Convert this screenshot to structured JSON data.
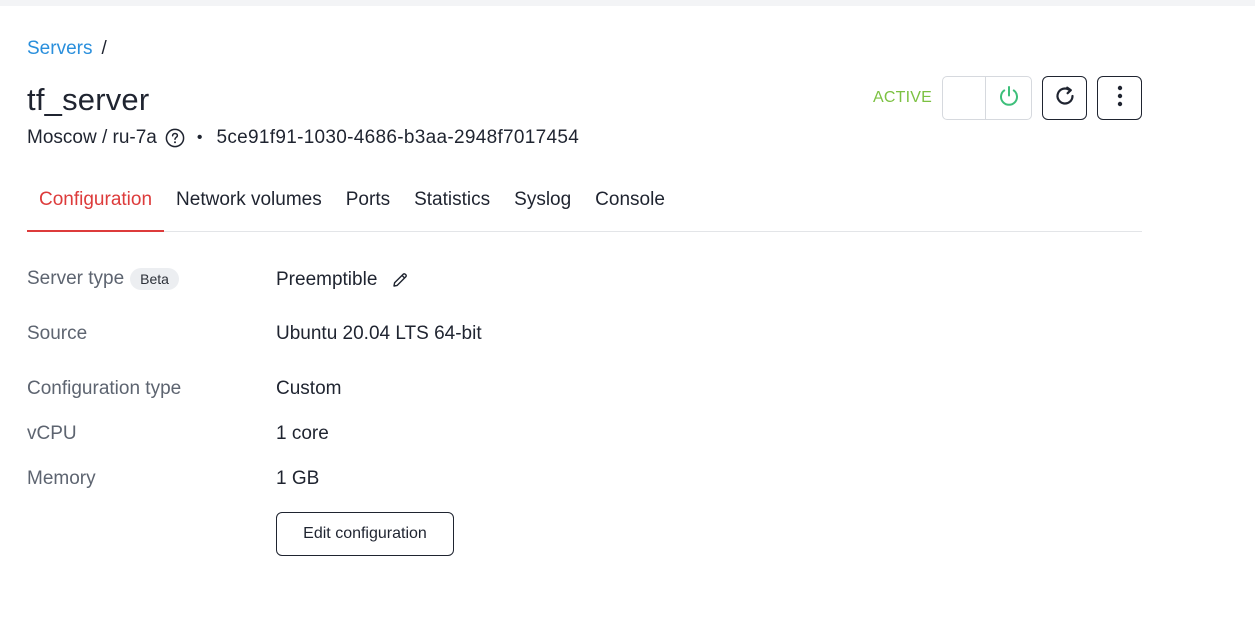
{
  "breadcrumb": {
    "root": "Servers",
    "separator": "/"
  },
  "server": {
    "name": "tf_server",
    "location": "Moscow / ru-7a",
    "separator_dot": "•",
    "uuid": "5ce91f91-1030-4686-b3aa-2948f7017454",
    "status": "ACTIVE"
  },
  "icons": {
    "help": "help-circle-icon",
    "power": "power-icon",
    "reboot": "reboot-icon",
    "more": "more-vertical-icon",
    "edit": "pencil-icon"
  },
  "colors": {
    "link": "#2a8fdc",
    "active_tab": "#dd3b3b",
    "status_active": "#7cc142",
    "power_icon": "#3dbf7a"
  },
  "tabs": [
    {
      "label": "Configuration",
      "active": true
    },
    {
      "label": "Network volumes",
      "active": false
    },
    {
      "label": "Ports",
      "active": false
    },
    {
      "label": "Statistics",
      "active": false
    },
    {
      "label": "Syslog",
      "active": false
    },
    {
      "label": "Console",
      "active": false
    }
  ],
  "config": {
    "server_type": {
      "label": "Server type",
      "badge": "Beta",
      "value": "Preemptible"
    },
    "source": {
      "label": "Source",
      "value": "Ubuntu 20.04 LTS 64-bit"
    },
    "configuration_type": {
      "label": "Configuration type",
      "value": "Custom"
    },
    "vcpu": {
      "label": "vCPU",
      "value": "1 core"
    },
    "memory": {
      "label": "Memory",
      "value": "1 GB"
    },
    "edit_button": "Edit configuration"
  }
}
